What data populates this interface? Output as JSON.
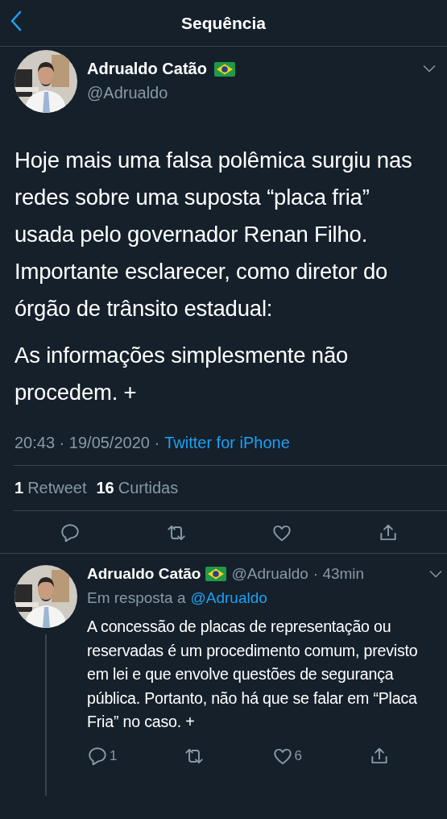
{
  "header": {
    "title": "Sequência"
  },
  "tweet": {
    "author": {
      "name": "Adrualdo Catão",
      "handle": "@Adrualdo"
    },
    "paragraphs": [
      "Hoje mais uma falsa polêmica surgiu nas redes sobre uma suposta “placa fria” usada pelo governador Renan Filho. Importante esclarecer, como diretor do órgão de trânsito estadual:",
      "As informações simplesmente não procedem. +"
    ],
    "timestamp": "20:43 · 19/05/2020 ·",
    "source": "Twitter for iPhone",
    "stats": [
      {
        "count": "1",
        "label": "Retweet"
      },
      {
        "count": "16",
        "label": "Curtidas"
      }
    ],
    "actions": [
      {
        "kind": "reply"
      },
      {
        "kind": "retweet"
      },
      {
        "kind": "like"
      },
      {
        "kind": "share"
      }
    ]
  },
  "reply": {
    "author": {
      "name": "Adrualdo Catão",
      "handle": "@Adrualdo"
    },
    "time": "· 43min",
    "reply_prefix": "Em resposta a",
    "reply_to": "@Adrualdo",
    "text": "A concessão de placas de representação ou reservadas é um procedimento comum, previsto em lei e que envolve questões de segurança pública. Portanto, não há que se falar em “Placa Fria” no caso. +",
    "actions": [
      {
        "kind": "reply",
        "count": "1"
      },
      {
        "kind": "retweet"
      },
      {
        "kind": "like",
        "count": "6"
      },
      {
        "kind": "share"
      }
    ]
  }
}
